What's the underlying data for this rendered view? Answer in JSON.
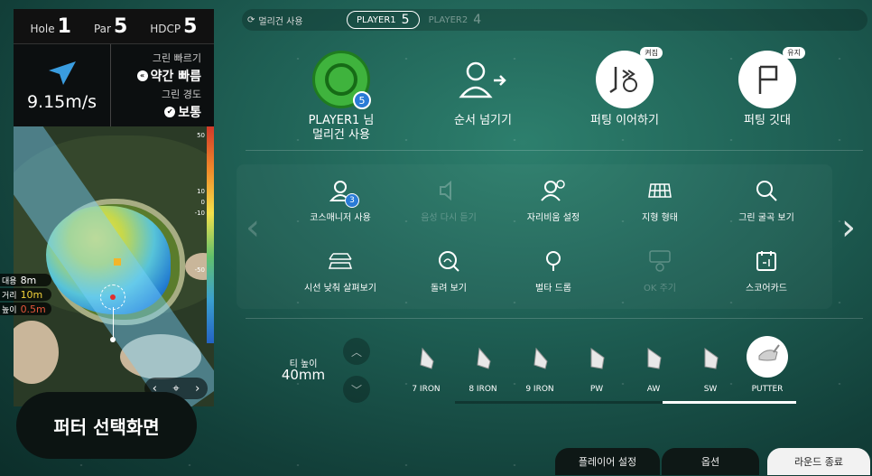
{
  "hole": {
    "hole_label": "Hole",
    "hole_value": "1",
    "par_label": "Par",
    "par_value": "5",
    "hdcp_label": "HDCP",
    "hdcp_value": "5"
  },
  "wind": {
    "speed": "9.15m/s"
  },
  "green": {
    "speed_label": "그린 빠르기",
    "speed_value": "약간 빠름",
    "firmness_label": "그린 경도",
    "firmness_value": "보통"
  },
  "map": {
    "scale_labels": [
      "50",
      "10",
      "0",
      "-10",
      "-50"
    ],
    "distances": [
      {
        "label": "대용",
        "value": "8m"
      },
      {
        "label": "거리",
        "value": "10m"
      },
      {
        "label": "높이",
        "value": "0.5m"
      }
    ],
    "nav": {
      "prev": "‹",
      "center": "⌖",
      "next": "›"
    }
  },
  "putter_select": "퍼터 선택화면",
  "top_bar": {
    "gimme_label": "멀리건 사용",
    "player1_label": "PLAYER1",
    "player1_value": "5",
    "player2_label": "PLAYER2",
    "player2_value": "4"
  },
  "top_actions": [
    {
      "label": "PLAYER1 님\n멀리건 사용",
      "badge": "5"
    },
    {
      "label": "순서 넘기기"
    },
    {
      "label": "퍼팅 이어하기",
      "badge": "켜짐"
    },
    {
      "label": "퍼팅 깃대",
      "badge": "유지"
    }
  ],
  "options": [
    {
      "label": "코스매니저 사용",
      "badge": "3"
    },
    {
      "label": "음성 다시 듣기"
    },
    {
      "label": "자리비움 설정"
    },
    {
      "label": "지형 형태"
    },
    {
      "label": "그린 굴곡 보기"
    },
    {
      "label": "시선 낮춰 살펴보기"
    },
    {
      "label": "돌려 보기"
    },
    {
      "label": "벌타 드롭"
    },
    {
      "label": "OK 주기"
    },
    {
      "label": "스코어카드"
    }
  ],
  "tee": {
    "label": "티 높이",
    "value": "40mm",
    "up": "︿",
    "down": "﹀"
  },
  "clubs": [
    "7 IRON",
    "8 IRON",
    "9 IRON",
    "PW",
    "AW",
    "SW",
    "PUTTER"
  ],
  "selected_club": "PUTTER",
  "bottom": {
    "player_settings": "플레이어 설정",
    "options": "옵션",
    "end_round": "라운드 종료"
  },
  "colors": {
    "accent_green": "#3fb33d",
    "badge_blue": "#2a7bd6"
  }
}
